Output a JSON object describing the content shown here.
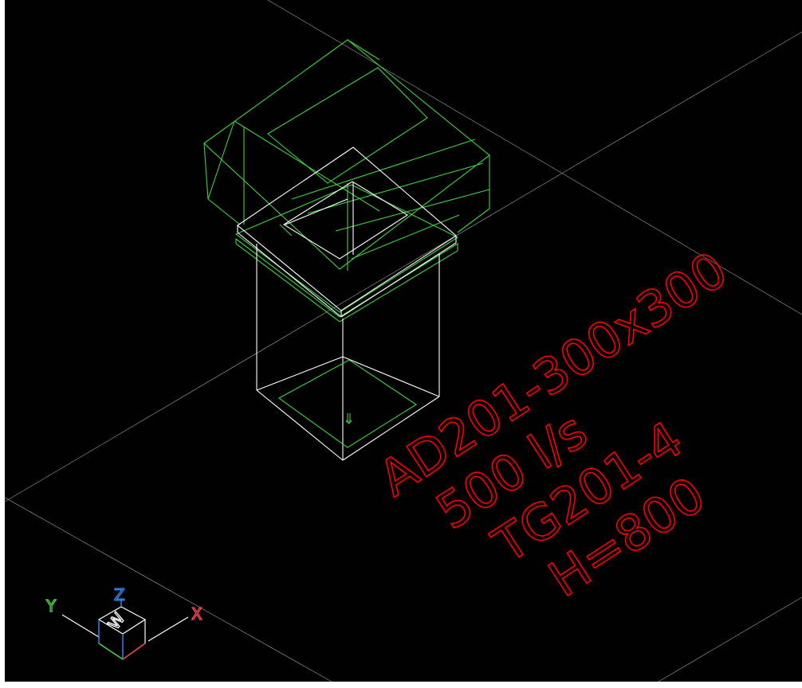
{
  "drawing": {
    "annotation_lines": [
      "AD201-300x300",
      "500 l/s",
      "TG201-4",
      "H=800"
    ],
    "flow_arrow_glyph": "⇓"
  },
  "ucs_icon": {
    "x_label": "X",
    "y_label": "Y",
    "z_label": "Z",
    "w_label": "W"
  },
  "colors": {
    "background": "#000000",
    "annotation": "#ff0000",
    "grid": "#c8c8c8",
    "model_green": "#3ed23e",
    "model_white": "#ffffff",
    "ucs_x": "#ff4d4d",
    "ucs_y": "#4cd94c",
    "ucs_z": "#2f8fff"
  }
}
